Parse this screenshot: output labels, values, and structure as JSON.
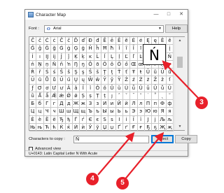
{
  "window": {
    "title": "Character Map",
    "minimize_glyph": "—",
    "maximize_glyph": "□",
    "close_glyph": "✕"
  },
  "font": {
    "label": "Font :",
    "selected": "Arial",
    "font_glyph": "O",
    "help_label": "Help"
  },
  "grid": {
    "rows": [
      [
        "Ĉ",
        "ĉ",
        "Ċ",
        "ċ",
        "Č",
        "č",
        "Ď",
        "ď",
        "Đ",
        "đ",
        "Ē",
        "ē",
        "Ĕ",
        "ĕ",
        "Ė",
        "ė",
        "Ę",
        "ę",
        "Ě",
        "ě"
      ],
      [
        "Ĝ",
        "ĝ",
        "Ğ",
        "ğ",
        "Ġ",
        "ġ",
        "Ģ",
        "ģ",
        "Ĥ",
        "ĥ",
        "Ħ",
        "ħ",
        "Ĩ",
        "ĩ",
        "Ī",
        "ī",
        "Ĭ",
        "ĭ",
        "Į",
        "į"
      ],
      [
        "İ",
        "ı",
        "Ĳ",
        "ĳ",
        "Ĵ",
        "ĵ",
        "Ķ",
        "ķ",
        "ĸ",
        "Ĺ",
        "ĺ",
        "Ļ",
        "ļ",
        "Ľ",
        "ľ",
        "Ŀ",
        "ŀ",
        "Ł",
        "ł",
        "Ń"
      ],
      [
        "ń",
        "Ņ",
        "ņ",
        "Ň",
        "ň",
        "ŉ",
        "Ŋ",
        "ŋ",
        "Ō",
        "ō",
        "Ŏ",
        "ŏ",
        "Ő",
        "ő",
        "Œ",
        "œ",
        "Ŕ",
        "ŕ",
        "Ŗ",
        "ŗ"
      ],
      [
        "Ř",
        "ř",
        "Ś",
        "ś",
        "Ŝ",
        "ŝ",
        "Ş",
        "ş",
        "Š",
        "š",
        "Ţ",
        "ţ",
        "Ť",
        "ť",
        "Ŧ",
        "ŧ",
        "Ũ",
        "ũ",
        "Ū",
        "ū"
      ],
      [
        "Ŭ",
        "ŭ",
        "Ů",
        "ů",
        "Ű",
        "ű",
        "Ų",
        "ų",
        "Ŵ",
        "ŵ",
        "Ŷ",
        "ŷ",
        "Ÿ",
        "Ź",
        "ź",
        "Ż",
        "ż",
        "Ž",
        "ž",
        "ſ"
      ],
      [
        "ƒ",
        "Ơ",
        "ơ",
        "Ư",
        "ư",
        "Ǎ",
        "ǎ",
        "Ǐ",
        "ǐ",
        "Ǒ",
        "ǒ",
        "Ǔ",
        "ǔ",
        "Ǖ",
        "ǖ",
        "Ǘ",
        "ǘ",
        "Ǚ",
        "ǚ",
        "Ǜ"
      ],
      [
        "ǜ",
        "Ǻ",
        "ǻ",
        "Ǽ",
        "ǽ",
        "Ǿ",
        "ǿ",
        "Ș",
        "ș",
        "Ț",
        "ț",
        "ȷ",
        "ˆ",
        "ˇ",
        "ˉ",
        "˘",
        "˙",
        "˚",
        "˛",
        "˜"
      ],
      [
        "Б",
        "б",
        "Г",
        "г",
        "Д",
        "д",
        "Ж",
        "ж",
        "З",
        "з",
        "И",
        "и",
        "Й",
        "й",
        "Л",
        "л",
        "П",
        "п",
        "Ф",
        "ф"
      ],
      [
        "Ц",
        "ц",
        "Ч",
        "ч",
        "Ш",
        "ш",
        "Щ",
        "щ",
        "Ъ",
        "ъ",
        "Ы",
        "ы",
        "Ь",
        "ь",
        "Э",
        "э",
        "Ю",
        "ю",
        "Я",
        "я"
      ],
      [
        "Ѐ",
        "ѐ",
        "Ё",
        "ё",
        "Ђ",
        "ђ",
        "Ѓ",
        "ѓ",
        "Є",
        "є",
        "Ѕ",
        "ѕ",
        "І",
        "і",
        "Ї",
        "ї",
        "Ј",
        "ј",
        "Љ",
        "љ"
      ],
      [
        "Њ",
        "њ",
        "Ћ",
        "ћ",
        "Ќ",
        "ќ",
        "Ѝ",
        "ѝ",
        "Ў",
        "ў",
        "Џ",
        "џ",
        "Ґ",
        "ґ",
        "Ғ",
        "ғ",
        "Ҕ",
        "ҕ",
        "Җ",
        "җ"
      ]
    ],
    "magnified_char": "Ń"
  },
  "copy": {
    "label": "Characters to copy :",
    "value": "Ń",
    "select_label": "Select",
    "copy_label": "Copy"
  },
  "advanced": {
    "label": "Advanced view",
    "checked": false
  },
  "status": {
    "text": "U+0143: Latin Capital Letter N With Acute"
  },
  "annotations": {
    "badges": [
      "3",
      "4",
      "5"
    ],
    "color": "#e8202a"
  }
}
